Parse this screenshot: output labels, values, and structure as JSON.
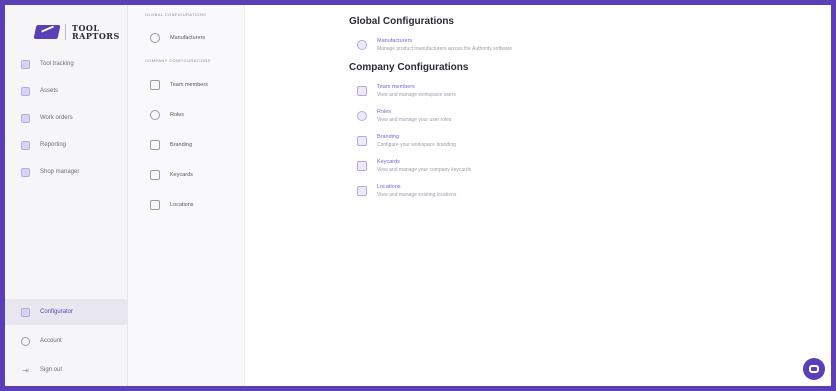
{
  "brand": {
    "line1": "TOOL",
    "line2": "RAPTORS"
  },
  "nav": {
    "items": [
      {
        "label": "Tool tracking",
        "icon": "tool-tracking-icon"
      },
      {
        "label": "Assets",
        "icon": "assets-icon"
      },
      {
        "label": "Work orders",
        "icon": "work-orders-icon"
      },
      {
        "label": "Reporting",
        "icon": "reporting-icon"
      },
      {
        "label": "Shop manager",
        "icon": "shop-manager-icon"
      }
    ],
    "bottom": [
      {
        "label": "Configurator",
        "icon": "configurator-icon"
      },
      {
        "label": "Account",
        "icon": "account-icon"
      },
      {
        "label": "Sign out",
        "icon": "sign-out-icon"
      }
    ]
  },
  "subnav": {
    "global_heading": "GLOBAL CONFIGURATIONS",
    "global_items": [
      {
        "label": "Manufacturers",
        "icon": "manufacturers-icon"
      }
    ],
    "company_heading": "COMPANY CONFIGURATIONS",
    "company_items": [
      {
        "label": "Team members",
        "icon": "team-members-icon"
      },
      {
        "label": "Roles",
        "icon": "roles-icon"
      },
      {
        "label": "Branding",
        "icon": "branding-icon"
      },
      {
        "label": "Keycards",
        "icon": "keycards-icon"
      },
      {
        "label": "Locations",
        "icon": "locations-icon"
      }
    ]
  },
  "main": {
    "global_title": "Global Configurations",
    "global_items": [
      {
        "name": "Manufacturers",
        "desc": "Manage product manufacturers across the Authority software"
      }
    ],
    "company_title": "Company Configurations",
    "company_items": [
      {
        "name": "Team members",
        "desc": "View and manage workspace users"
      },
      {
        "name": "Roles",
        "desc": "View and manage your user roles"
      },
      {
        "name": "Branding",
        "desc": "Configure your workspace branding"
      },
      {
        "name": "Keycards",
        "desc": "View and manage your company keycards"
      },
      {
        "name": "Locations",
        "desc": "View and manage existing locations"
      }
    ]
  },
  "colors": {
    "accent": "#5b3fb8",
    "link": "#7d63d6"
  }
}
